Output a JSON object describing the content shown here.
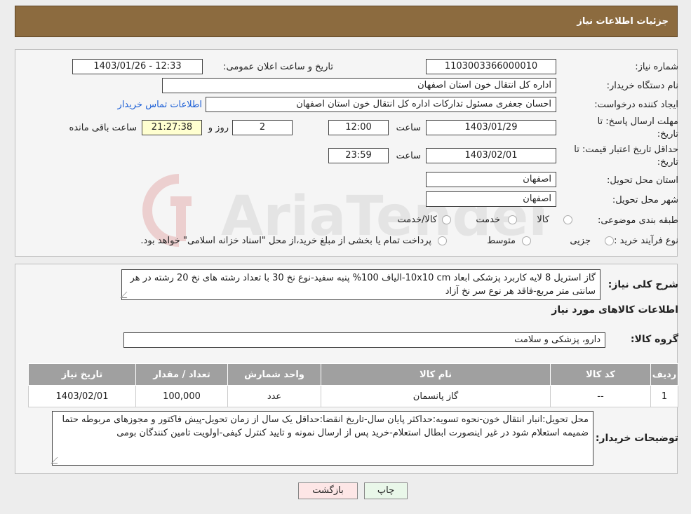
{
  "header": {
    "title": "جزئیات اطلاعات نیاز"
  },
  "form": {
    "need_number_label": "شماره نیاز:",
    "need_number": "1103003366000010",
    "announce_label": "تاریخ و ساعت اعلان عمومی:",
    "announce_value": "1403/01/26 - 12:33",
    "buyer_label": "نام دستگاه خریدار:",
    "buyer_value": "اداره کل انتقال خون استان اصفهان",
    "creator_label": "ایجاد کننده درخواست:",
    "creator_value": "احسان جعفری مسئول تدارکات اداره کل انتقال خون استان اصفهان",
    "contact_link": "اطلاعات تماس خریدار",
    "deadline_label_1": "مهلت ارسال پاسخ: تا",
    "deadline_label_2": "تاریخ:",
    "deadline_date": "1403/01/29",
    "time_label": "ساعت",
    "deadline_time": "12:00",
    "days_value": "2",
    "day_label": "روز و",
    "remaining_time": "21:27:38",
    "remaining_label": "ساعت باقی مانده",
    "validity_label_1": "حداقل تاریخ اعتبار قیمت: تا",
    "validity_label_2": "تاریخ:",
    "validity_date": "1403/02/01",
    "validity_time": "23:59",
    "province_label": "استان محل تحویل:",
    "province_value": "اصفهان",
    "city_label": "شهر محل تحویل:",
    "city_value": "اصفهان",
    "category_label": "طبقه بندی موضوعی:",
    "category_options": [
      "کالا",
      "خدمت",
      "کالا/خدمت"
    ],
    "process_label": "نوع فرآیند خرید :",
    "process_options": [
      "جزیی",
      "متوسط"
    ],
    "payment_note": "پرداخت تمام یا بخشی از مبلغ خرید،از محل \"اسناد خزانه اسلامی\" خواهد بود."
  },
  "details": {
    "description_label": "شرح کلی نیاز:",
    "description": "گاز استریل 8 لایه کاربرد پزشکی ابعاد 10x10 cm-الیاف 100% پنبه سفید-نوع نخ 30 با تعداد رشته های نخ 20 رشته در هر سانتی متر مربع-فاقد هر نوع سر نخ آزاد",
    "goods_info_title": "اطلاعات کالاهای مورد نیاز",
    "group_label": "گروه کالا:",
    "group_value": "دارو، پزشکی و سلامت",
    "table": {
      "headers": [
        "ردیف",
        "کد کالا",
        "نام کالا",
        "واحد شمارش",
        "تعداد / مقدار",
        "تاریخ نیاز"
      ],
      "rows": [
        [
          "1",
          "--",
          "گاز پانسمان",
          "عدد",
          "100,000",
          "1403/02/01"
        ]
      ]
    },
    "notes_label": "توضیحات خریدار:",
    "notes": "محل تحویل:انبار انتقال خون-نحوه تسویه:حداکثر پایان سال-تاریخ انقضا:حداقل یک سال از زمان تحویل-پیش فاکتور و مجوزهای مربوطه حتما ضمیمه استعلام شود در غیر اینصورت ابطال استعلام-خرید پس از ارسال نمونه و تایید کنترل کیفی-اولویت تامین کنندگان بومی"
  },
  "buttons": {
    "print": "چاپ",
    "back": "بازگشت"
  },
  "watermark": {
    "text": "AriaTender.neT"
  }
}
